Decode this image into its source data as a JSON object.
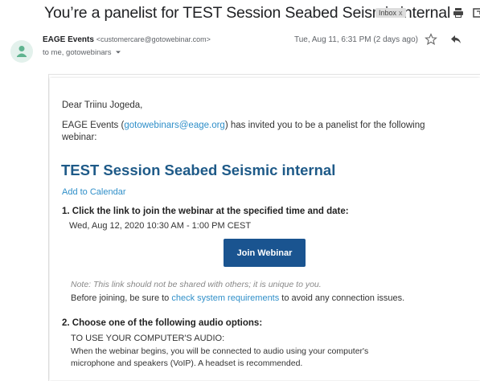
{
  "email": {
    "subject": "You’re a panelist for TEST Session Seabed Seismic internal",
    "label": "Inbox",
    "label_close": "x",
    "sender_name": "EAGE Events",
    "sender_email": "<customercare@gotowebinar.com>",
    "recipients": "to me, gotowebinars",
    "date": "Tue, Aug 11, 6:31 PM (2 days ago)"
  },
  "body": {
    "greeting": "Dear Triinu Jogeda,",
    "invite_prefix": "EAGE Events (",
    "invite_link": "gotowebinars@eage.org",
    "invite_suffix": ") has invited you to be a panelist for the following",
    "invite_line2": "webinar:",
    "webinar_title": "TEST Session Seabed Seismic internal",
    "add_to_calendar": "Add to Calendar",
    "step1": "1. Click the link to join the webinar at the specified time and date:",
    "datetime": "Wed, Aug 12, 2020 10:30 AM - 1:00 PM CEST",
    "join_button": "Join Webinar",
    "note": "Note: This link should not be shared with others; it is unique to you.",
    "before_prefix": "Before joining, be sure to ",
    "before_link": "check system requirements",
    "before_suffix": " to avoid any connection issues.",
    "step2": "2. Choose one of the following audio options:",
    "audio_heading": "TO USE YOUR COMPUTER'S AUDIO:",
    "audio_line1": "When the webinar begins, you will be connected to audio using your computer's",
    "audio_line2": "microphone and speakers (VoIP). A headset is recommended."
  },
  "icons": {
    "print": "print-icon",
    "popout": "open-in-new-window-icon",
    "avatar": "person-avatar-icon",
    "star": "star-icon",
    "reply": "reply-icon",
    "dropdown": "chevron-down-icon"
  },
  "colors": {
    "link": "#2f8fc9",
    "title": "#1e5a88",
    "button": "#1a5490",
    "badge": "#dddddd",
    "avatar": "#e3f1ec"
  }
}
